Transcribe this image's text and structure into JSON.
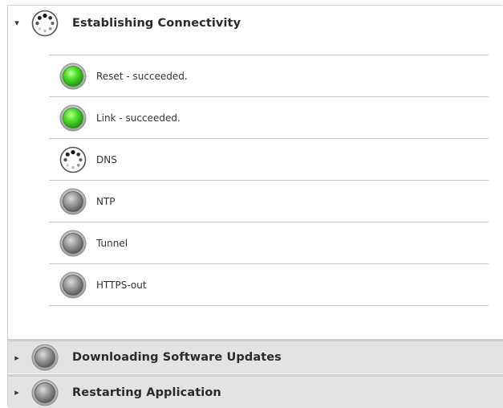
{
  "sections": [
    {
      "title": "Establishing Connectivity",
      "state": "expanded",
      "status_icon": "spinner-icon",
      "steps": [
        {
          "label": "Reset - succeeded.",
          "status": "success",
          "icon": "green-status-light-icon"
        },
        {
          "label": "Link - succeeded.",
          "status": "success",
          "icon": "green-status-light-icon"
        },
        {
          "label": "DNS",
          "status": "in-progress",
          "icon": "spinner-icon"
        },
        {
          "label": "NTP",
          "status": "pending",
          "icon": "gray-status-light-icon"
        },
        {
          "label": "Tunnel",
          "status": "pending",
          "icon": "gray-status-light-icon"
        },
        {
          "label": "HTTPS-out",
          "status": "pending",
          "icon": "gray-status-light-icon"
        }
      ]
    },
    {
      "title": "Downloading Software Updates",
      "state": "collapsed",
      "status_icon": "gray-status-light-icon"
    },
    {
      "title": "Restarting Application",
      "state": "collapsed",
      "status_icon": "gray-status-light-icon"
    }
  ],
  "colors": {
    "success": "#3fd22a",
    "pending": "#8a8a8a",
    "collapsed_header_bg": "#e3e3e3"
  }
}
